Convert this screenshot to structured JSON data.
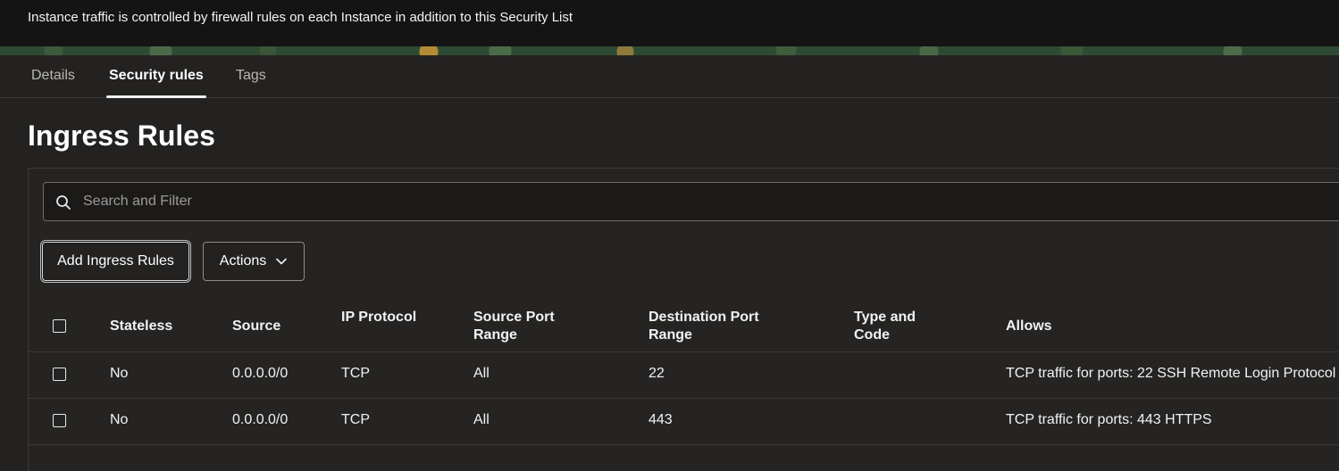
{
  "banner": {
    "message": "Instance traffic is controlled by firewall rules on each Instance in addition to this Security List"
  },
  "tabs": [
    {
      "label": "Details",
      "active": false
    },
    {
      "label": "Security rules",
      "active": true
    },
    {
      "label": "Tags",
      "active": false
    }
  ],
  "section": {
    "title": "Ingress Rules"
  },
  "search": {
    "placeholder": "Search and Filter",
    "value": ""
  },
  "toolbar": {
    "add_label": "Add Ingress Rules",
    "actions_label": "Actions"
  },
  "table": {
    "columns": {
      "stateless": "Stateless",
      "source": "Source",
      "ip_protocol": "IP Protocol",
      "source_port_range": "Source Port Range",
      "destination_port_range": "Destination Port Range",
      "type_and_code": "Type and Code",
      "allows": "Allows"
    },
    "rows": [
      {
        "stateless": "No",
        "source": "0.0.0.0/0",
        "ip_protocol": "TCP",
        "source_port_range": "All",
        "destination_port_range": "22",
        "type_and_code": "",
        "allows": "TCP traffic for ports: 22 SSH Remote Login Protocol"
      },
      {
        "stateless": "No",
        "source": "0.0.0.0/0",
        "ip_protocol": "TCP",
        "source_port_range": "All",
        "destination_port_range": "443",
        "type_and_code": "",
        "allows": "TCP traffic for ports: 443 HTTPS"
      }
    ]
  }
}
